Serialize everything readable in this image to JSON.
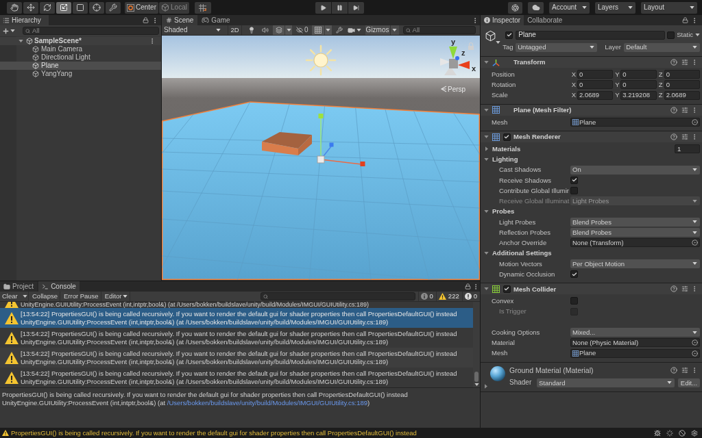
{
  "toolbar": {
    "tools": [
      {
        "kind": "hand",
        "selected": false
      },
      {
        "kind": "move",
        "selected": false
      },
      {
        "kind": "rotate",
        "selected": false
      },
      {
        "kind": "scale",
        "selected": true
      },
      {
        "kind": "rect",
        "selected": false
      },
      {
        "kind": "transform",
        "selected": false
      },
      {
        "kind": "custom",
        "selected": false
      }
    ],
    "pivot": [
      {
        "kind": "center",
        "label": "Center",
        "disabled": false
      },
      {
        "kind": "local",
        "label": "Local",
        "disabled": true
      }
    ],
    "menus": [
      {
        "kind": "account",
        "label": "Account"
      },
      {
        "kind": "layers",
        "label": "Layers"
      },
      {
        "kind": "layout",
        "label": "Layout"
      }
    ]
  },
  "hierarchy": {
    "tab": "Hierarchy",
    "search": {
      "placeholder": "All"
    },
    "scene": {
      "label": "SampleScene*",
      "expanded": true,
      "children": [
        {
          "label": "Main Camera",
          "selected": false
        },
        {
          "label": "Directional Light",
          "selected": false
        },
        {
          "label": "Plane",
          "selected": true
        },
        {
          "label": "YangYang",
          "selected": false
        }
      ]
    }
  },
  "scene_view": {
    "tabs": [
      {
        "kind": "scene",
        "label": "Scene",
        "selected": true
      },
      {
        "kind": "game",
        "label": "Game",
        "selected": false
      }
    ],
    "shading": "Shaded",
    "mode_2d": {
      "label": "2D",
      "on": false
    },
    "toggles": [
      {
        "kind": "lighting",
        "on": false
      },
      {
        "kind": "audio",
        "on": false
      },
      {
        "kind": "effects",
        "on": true
      }
    ],
    "hidden_count": "0",
    "grid": {
      "on": true
    },
    "gizmos": {
      "label": "Gizmos",
      "on": true
    },
    "search": {
      "placeholder": "All"
    },
    "orientation_axes": [
      {
        "kind": "y",
        "label": "y"
      },
      {
        "kind": "z",
        "label": "z"
      },
      {
        "kind": "x",
        "label": "x"
      }
    ],
    "projection": "Persp"
  },
  "inspector": {
    "tabs": [
      {
        "kind": "inspector",
        "label": "Inspector",
        "selected": true
      },
      {
        "kind": "collaborate",
        "label": "Collaborate",
        "selected": false
      }
    ],
    "object": {
      "active": true,
      "name": "Plane",
      "static": false,
      "static_label": "Static",
      "tag_label": "Tag",
      "tag": "Untagged",
      "layer_label": "Layer",
      "layer": "Default"
    },
    "components": [
      {
        "kind": "transform",
        "title": "Transform",
        "expanded": true,
        "rows": [
          {
            "kind": "vector3",
            "label": "Position",
            "values": [
              {
                "axis": "X",
                "value": "0"
              },
              {
                "axis": "Y",
                "value": "0"
              },
              {
                "axis": "Z",
                "value": "0"
              }
            ]
          },
          {
            "kind": "vector3",
            "label": "Rotation",
            "values": [
              {
                "axis": "X",
                "value": "0"
              },
              {
                "axis": "Y",
                "value": "0"
              },
              {
                "axis": "Z",
                "value": "0"
              }
            ]
          },
          {
            "kind": "vector3",
            "label": "Scale",
            "values": [
              {
                "axis": "X",
                "value": "2.0689"
              },
              {
                "axis": "Y",
                "value": "3.219208"
              },
              {
                "axis": "Z",
                "value": "2.0689"
              }
            ]
          }
        ]
      },
      {
        "kind": "mesh_filter",
        "title": "Plane (Mesh Filter)",
        "expanded": true,
        "rows": [
          {
            "kind": "object",
            "label": "Mesh",
            "value": "Plane",
            "assigned": true
          }
        ]
      },
      {
        "kind": "mesh_renderer",
        "title": "Mesh Renderer",
        "enabled": true,
        "expanded": true,
        "rows": [
          {
            "kind": "foldout",
            "label": "Materials",
            "expanded": false,
            "count": "1"
          },
          {
            "kind": "foldout",
            "label": "Lighting",
            "expanded": true,
            "children": [
              {
                "kind": "dropdown",
                "label": "Cast Shadows",
                "value": "On",
                "disabled": false
              },
              {
                "kind": "checkbox",
                "label": "Receive Shadows",
                "checked": true,
                "disabled": false
              },
              {
                "kind": "checkbox",
                "label": "Contribute Global Illumir",
                "checked": false,
                "disabled": false
              },
              {
                "kind": "dropdown",
                "label": "Receive Global Illuminat",
                "value": "Light Probes",
                "disabled": true
              }
            ]
          },
          {
            "kind": "foldout",
            "label": "Probes",
            "expanded": true,
            "children": [
              {
                "kind": "dropdown",
                "label": "Light Probes",
                "value": "Blend Probes"
              },
              {
                "kind": "dropdown",
                "label": "Reflection Probes",
                "value": "Blend Probes"
              },
              {
                "kind": "object",
                "label": "Anchor Override",
                "value": "None (Transform)",
                "assigned": false
              }
            ]
          },
          {
            "kind": "foldout",
            "label": "Additional Settings",
            "expanded": true,
            "children": [
              {
                "kind": "dropdown",
                "label": "Motion Vectors",
                "value": "Per Object Motion"
              },
              {
                "kind": "checkbox",
                "label": "Dynamic Occlusion",
                "checked": true
              }
            ]
          }
        ]
      },
      {
        "kind": "mesh_collider",
        "title": "Mesh Collider",
        "enabled": true,
        "expanded": true,
        "rows": [
          {
            "kind": "checkbox",
            "label": "Convex",
            "checked": false,
            "children": [
              {
                "kind": "checkbox",
                "label": "Is Trigger",
                "checked": false,
                "disabled": true
              }
            ]
          },
          {
            "kind": "dropdown",
            "label": "Cooking Options",
            "value": "Mixed..."
          },
          {
            "kind": "object",
            "label": "Material",
            "value": "None (Physic Material)",
            "assigned": false
          },
          {
            "kind": "object",
            "label": "Mesh",
            "value": "Plane",
            "assigned": true
          }
        ]
      }
    ],
    "material": {
      "title": "Ground Material (Material)",
      "expanded": false,
      "shader_label": "Shader",
      "shader": "Standard",
      "edit": "Edit..."
    }
  },
  "console": {
    "tabs": [
      {
        "kind": "project",
        "label": "Project",
        "selected": false
      },
      {
        "kind": "console",
        "label": "Console",
        "selected": true
      }
    ],
    "buttons": [
      {
        "kind": "clear",
        "label": "Clear"
      },
      {
        "kind": "collapse",
        "label": "Collapse"
      },
      {
        "kind": "error_pause",
        "label": "Error Pause"
      },
      {
        "kind": "editor",
        "label": "Editor"
      }
    ],
    "counts": [
      {
        "kind": "info",
        "count": "0"
      },
      {
        "kind": "warning",
        "count": "222"
      },
      {
        "kind": "error",
        "count": "0"
      }
    ],
    "messages": [
      {
        "trace": "UnityEngine.GUIUtility:ProcessEvent (int,intptr,bool&) (at /Users/bokken/buildslave/unity/build/Modules/IMGUI/GUIUtility.cs:189)",
        "selected": false
      },
      {
        "text": "[13:54:22] PropertiesGUI() is being called recursively. If you want to render the default gui for shader properties then call PropertiesDefaultGUI() instead",
        "trace": "UnityEngine.GUIUtility:ProcessEvent (int,intptr,bool&) (at /Users/bokken/buildslave/unity/build/Modules/IMGUI/GUIUtility.cs:189)",
        "selected": true
      },
      {
        "text": "[13:54:22] PropertiesGUI() is being called recursively. If you want to render the default gui for shader properties then call PropertiesDefaultGUI() instead",
        "trace": "UnityEngine.GUIUtility:ProcessEvent (int,intptr,bool&) (at /Users/bokken/buildslave/unity/build/Modules/IMGUI/GUIUtility.cs:189)",
        "selected": false
      },
      {
        "text": "[13:54:22] PropertiesGUI() is being called recursively. If you want to render the default gui for shader properties then call PropertiesDefaultGUI() instead",
        "trace": "UnityEngine.GUIUtility:ProcessEvent (int,intptr,bool&) (at /Users/bokken/buildslave/unity/build/Modules/IMGUI/GUIUtility.cs:189)",
        "selected": false
      },
      {
        "text": "[13:54:22] PropertiesGUI() is being called recursively. If you want to render the default gui for shader properties then call PropertiesDefaultGUI() instead",
        "trace": "UnityEngine.GUIUtility:ProcessEvent (int,intptr,bool&) (at /Users/bokken/buildslave/unity/build/Modules/IMGUI/GUIUtility.cs:189)",
        "selected": false
      }
    ],
    "details": {
      "message": "PropertiesGUI() is being called recursively. If you want to render the default gui for shader properties then call PropertiesDefaultGUI() instead",
      "trace": "UnityEngine.GUIUtility:ProcessEvent (int,intptr,bool&) (at",
      "link": "/Users/bokken/buildslave/unity/build/Modules/IMGUI/GUIUtility.cs:189",
      "trace_end": ")"
    }
  },
  "status_bar": {
    "message": "PropertiesGUI() is being called recursively. If you want to render the default gui for shader properties then call PropertiesDefaultGUI() instead"
  }
}
